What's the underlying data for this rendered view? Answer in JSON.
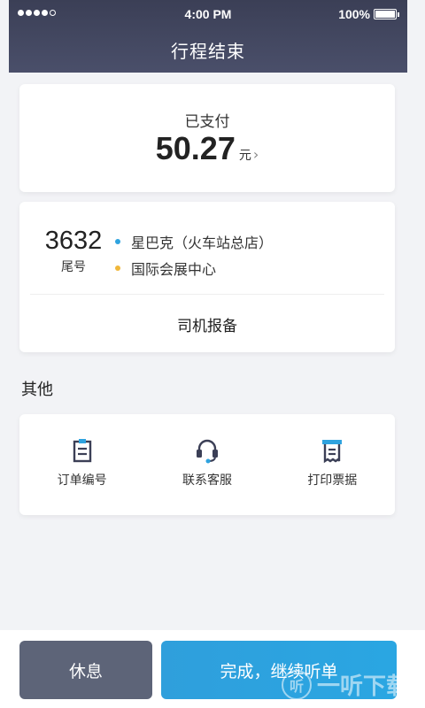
{
  "status_bar": {
    "time": "4:00 PM",
    "battery": "100%",
    "battery_level": 1.0,
    "signal_bars": 5,
    "signal_filled": 4
  },
  "header": {
    "title": "行程结束"
  },
  "payment": {
    "status": "已支付",
    "amount": "50.27",
    "currency": "元",
    "chevron": "›"
  },
  "trip": {
    "plate_number": "3632",
    "plate_label": "尾号",
    "start": "星巴克（火车站总店）",
    "end": "国际会展中心",
    "start_dot_color": "#2fa3df",
    "end_dot_color": "#f0b73a",
    "report_label": "司机报备"
  },
  "other": {
    "title": "其他",
    "actions": [
      {
        "label": "订单编号",
        "icon": "clipboard-icon"
      },
      {
        "label": "联系客服",
        "icon": "headset-icon"
      },
      {
        "label": "打印票据",
        "icon": "printer-icon"
      }
    ]
  },
  "bottom": {
    "rest_label": "休息",
    "continue_label": "完成，继续听单"
  },
  "watermark": {
    "icon_text": "听",
    "text": "一听下载"
  },
  "colors": {
    "header_bg": "#3b3f56",
    "accent_blue": "#2fa3df",
    "rest_button": "#5d6478"
  }
}
